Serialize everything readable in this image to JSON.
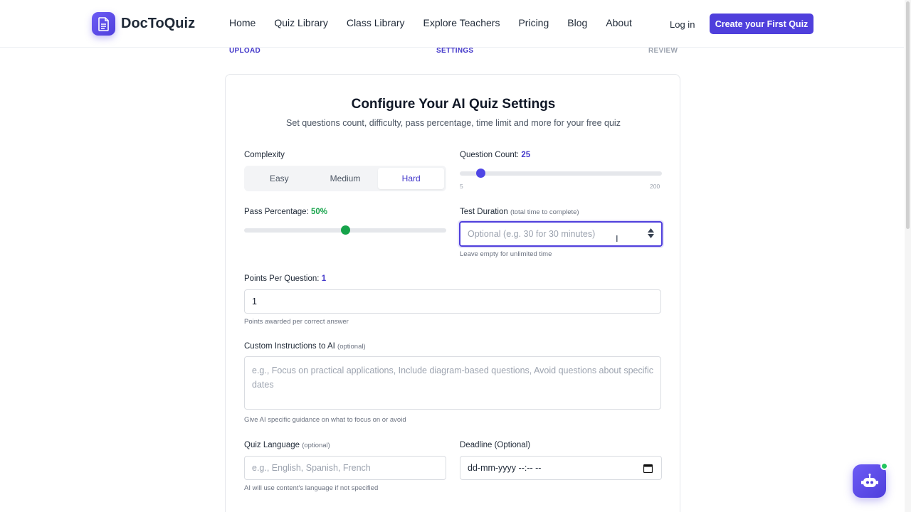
{
  "header": {
    "logo_text": "DocToQuiz",
    "nav": [
      "Home",
      "Quiz Library",
      "Class Library",
      "Explore Teachers",
      "Pricing",
      "Blog",
      "About"
    ],
    "login_label": "Log in",
    "cta_label": "Create your First Quiz"
  },
  "steps": {
    "upload": "UPLOAD",
    "settings": "SETTINGS",
    "review": "REVIEW"
  },
  "form": {
    "title": "Configure Your AI Quiz Settings",
    "subtitle": "Set questions count, difficulty, pass percentage, time limit and more for your free quiz",
    "complexity": {
      "label": "Complexity",
      "options": [
        "Easy",
        "Medium",
        "Hard"
      ],
      "selected": "Hard"
    },
    "question_count": {
      "label": "Question Count:",
      "value": "25",
      "min": "5",
      "max": "200",
      "fraction": 0.103
    },
    "pass_percentage": {
      "label": "Pass Percentage:",
      "value": "50%",
      "fraction": 0.5
    },
    "test_duration": {
      "label": "Test Duration",
      "hint": "(total time to complete)",
      "placeholder": "Optional (e.g. 30 for 30 minutes)",
      "help": "Leave empty for unlimited time"
    },
    "points_per_question": {
      "label": "Points Per Question:",
      "label_value": "1",
      "value": "1",
      "help": "Points awarded per correct answer"
    },
    "custom_instructions": {
      "label": "Custom Instructions to AI",
      "hint": "(optional)",
      "placeholder": "e.g., Focus on practical applications, Include diagram-based questions, Avoid questions about specific dates",
      "help": "Give AI specific guidance on what to focus on or avoid"
    },
    "quiz_language": {
      "label": "Quiz Language",
      "hint": "(optional)",
      "placeholder": "e.g., English, Spanish, French",
      "help": "AI will use content's language if not specified"
    },
    "deadline": {
      "label": "Deadline (Optional)",
      "value": "dd-mm-yyyy --:-- --"
    }
  },
  "colors": {
    "accent": "#4f3fdc",
    "success": "#16a34a"
  }
}
